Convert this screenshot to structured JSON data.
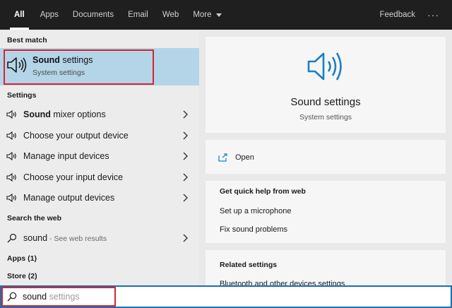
{
  "tabs": [
    {
      "label": "All"
    },
    {
      "label": "Apps"
    },
    {
      "label": "Documents"
    },
    {
      "label": "Email"
    },
    {
      "label": "Web"
    },
    {
      "label": "More"
    }
  ],
  "topbar": {
    "feedback": "Feedback",
    "more_options": "···"
  },
  "left": {
    "best_match_label": "Best match",
    "best_match": {
      "title_bold": "Sound",
      "title_rest": " settings",
      "subtitle": "System settings"
    },
    "settings_label": "Settings",
    "settings_items": [
      {
        "bold": "Sound",
        "rest": " mixer options"
      },
      {
        "bold": "",
        "rest": "Choose your output device"
      },
      {
        "bold": "",
        "rest": "Manage input devices"
      },
      {
        "bold": "",
        "rest": "Choose your input device"
      },
      {
        "bold": "",
        "rest": "Manage output devices"
      }
    ],
    "web_label": "Search the web",
    "web_item": {
      "query": "sound",
      "sub": " - See web results"
    },
    "apps_label": "Apps (1)",
    "store_label": "Store (2)"
  },
  "right": {
    "title": "Sound settings",
    "subtitle": "System settings",
    "open": "Open",
    "help_heading": "Get quick help from web",
    "help_links": [
      "Set up a microphone",
      "Fix sound problems"
    ],
    "related_heading": "Related settings",
    "related_links": [
      "Bluetooth and other devices settings"
    ]
  },
  "search": {
    "typed": "sound",
    "suggestion": " settings"
  },
  "colors": {
    "accent": "#1a6fb5",
    "highlight": "#b4d5e8",
    "annotation": "#d6252e"
  }
}
